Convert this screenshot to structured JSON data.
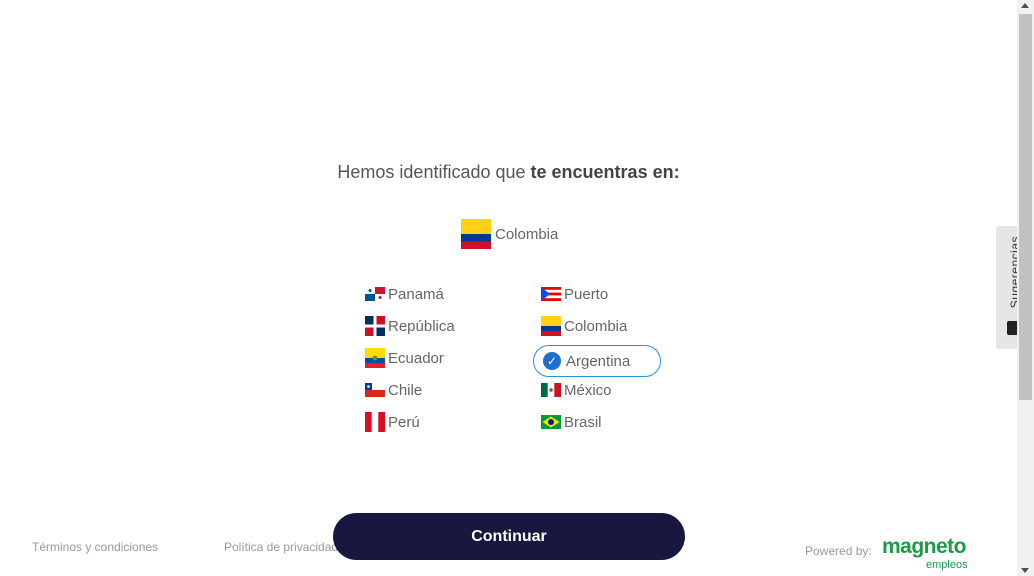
{
  "heading": {
    "normal": "Hemos identificado que ",
    "bold": "te encuentras en:"
  },
  "detected_country": {
    "label": "Colombia",
    "flag": "colombia-flag"
  },
  "countries": [
    {
      "label": "Panamá",
      "flag": "panama-flag"
    },
    {
      "label": "República",
      "flag": "dominican-republic-flag"
    },
    {
      "label": "Ecuador",
      "flag": "ecuador-flag"
    },
    {
      "label": "Chile",
      "flag": "chile-flag"
    },
    {
      "label": "Perú",
      "flag": "peru-flag"
    },
    {
      "label": "Puerto",
      "flag": "puerto-rico-flag"
    },
    {
      "label": "Colombia",
      "flag": "colombia-flag"
    },
    {
      "label": "Argentina",
      "flag": "check-icon",
      "selected": true
    },
    {
      "label": "México",
      "flag": "mexico-flag"
    },
    {
      "label": "Brasil",
      "flag": "brazil-flag"
    }
  ],
  "continue_label": "Continuar",
  "footer": {
    "terms": "Términos y condiciones",
    "privacy": "Política de privacidad",
    "powered_by": "Powered by:",
    "logo_main": "magneto",
    "logo_sub": "empleos"
  },
  "feedback_tab": {
    "label": "Sugerencias"
  },
  "colors": {
    "accent": "#17173f",
    "selected_border": "#2a8fd6",
    "logo_green": "#1a9c45"
  }
}
